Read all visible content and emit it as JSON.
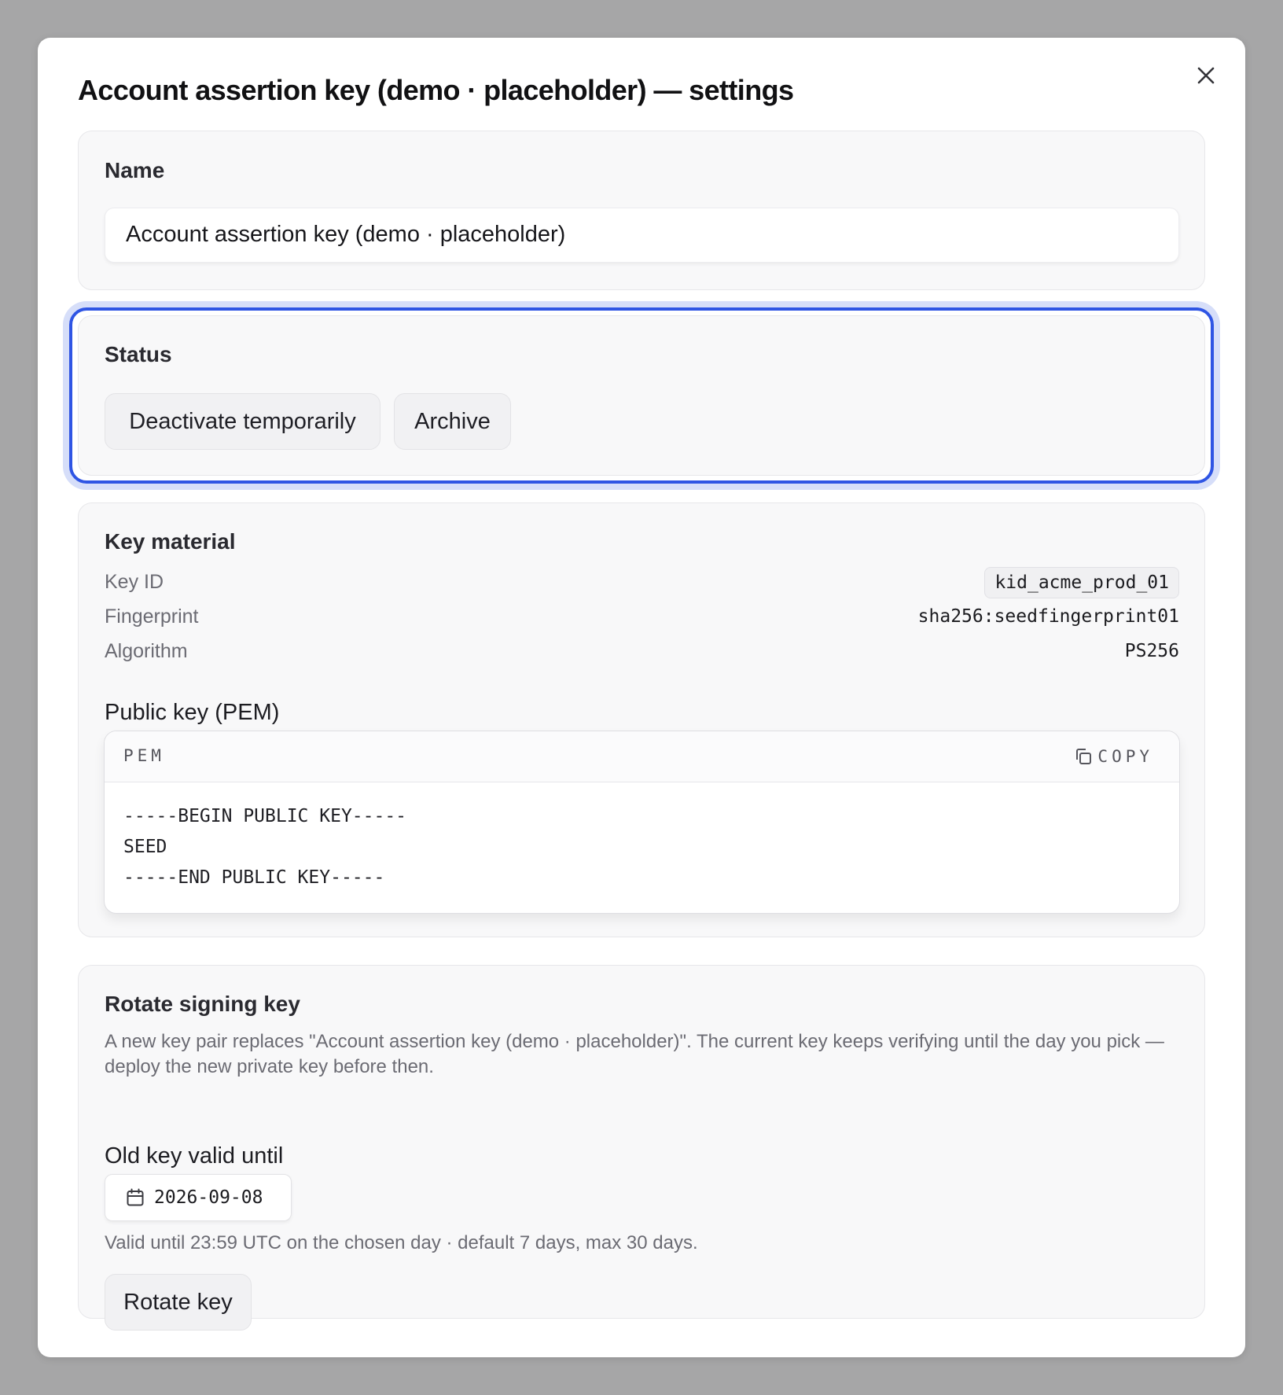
{
  "dialog": {
    "title": "Account assertion key (demo · placeholder) — settings",
    "close_icon": "close-icon"
  },
  "name_section": {
    "heading": "Name",
    "value": "Account assertion key (demo · placeholder)"
  },
  "status_section": {
    "heading": "Status",
    "buttons": {
      "deactivate": "Deactivate temporarily",
      "archive": "Archive"
    }
  },
  "key_material": {
    "heading": "Key material",
    "rows": [
      {
        "label": "Key ID",
        "value": "kid_acme_prod_01"
      },
      {
        "label": "Fingerprint",
        "value": "sha256:seedfingerprint01"
      },
      {
        "label": "Algorithm",
        "value": "PS256"
      }
    ],
    "public_key": {
      "heading": "Public key (PEM)",
      "tag": "PEM",
      "copy_label": "COPY",
      "copy_icon": "copy-icon",
      "lines": [
        "-----BEGIN PUBLIC KEY-----",
        "SEED",
        "-----END PUBLIC KEY-----"
      ]
    }
  },
  "rotate_section": {
    "heading": "Rotate signing key",
    "description": "A new key pair replaces \"Account assertion key (demo · placeholder)\". The current key keeps verifying until the day you pick — deploy the new private key before then.",
    "valid_until_label": "Old key valid until",
    "date_value": "2026-09-08",
    "date_icon": "calendar-icon",
    "hint": "Valid until 23:59 UTC on the chosen day · default 7 days, max 30 days.",
    "button_label": "Rotate key"
  },
  "colors": {
    "focus_ring": "#2f55e4",
    "backdrop": "#a6a6a7"
  }
}
